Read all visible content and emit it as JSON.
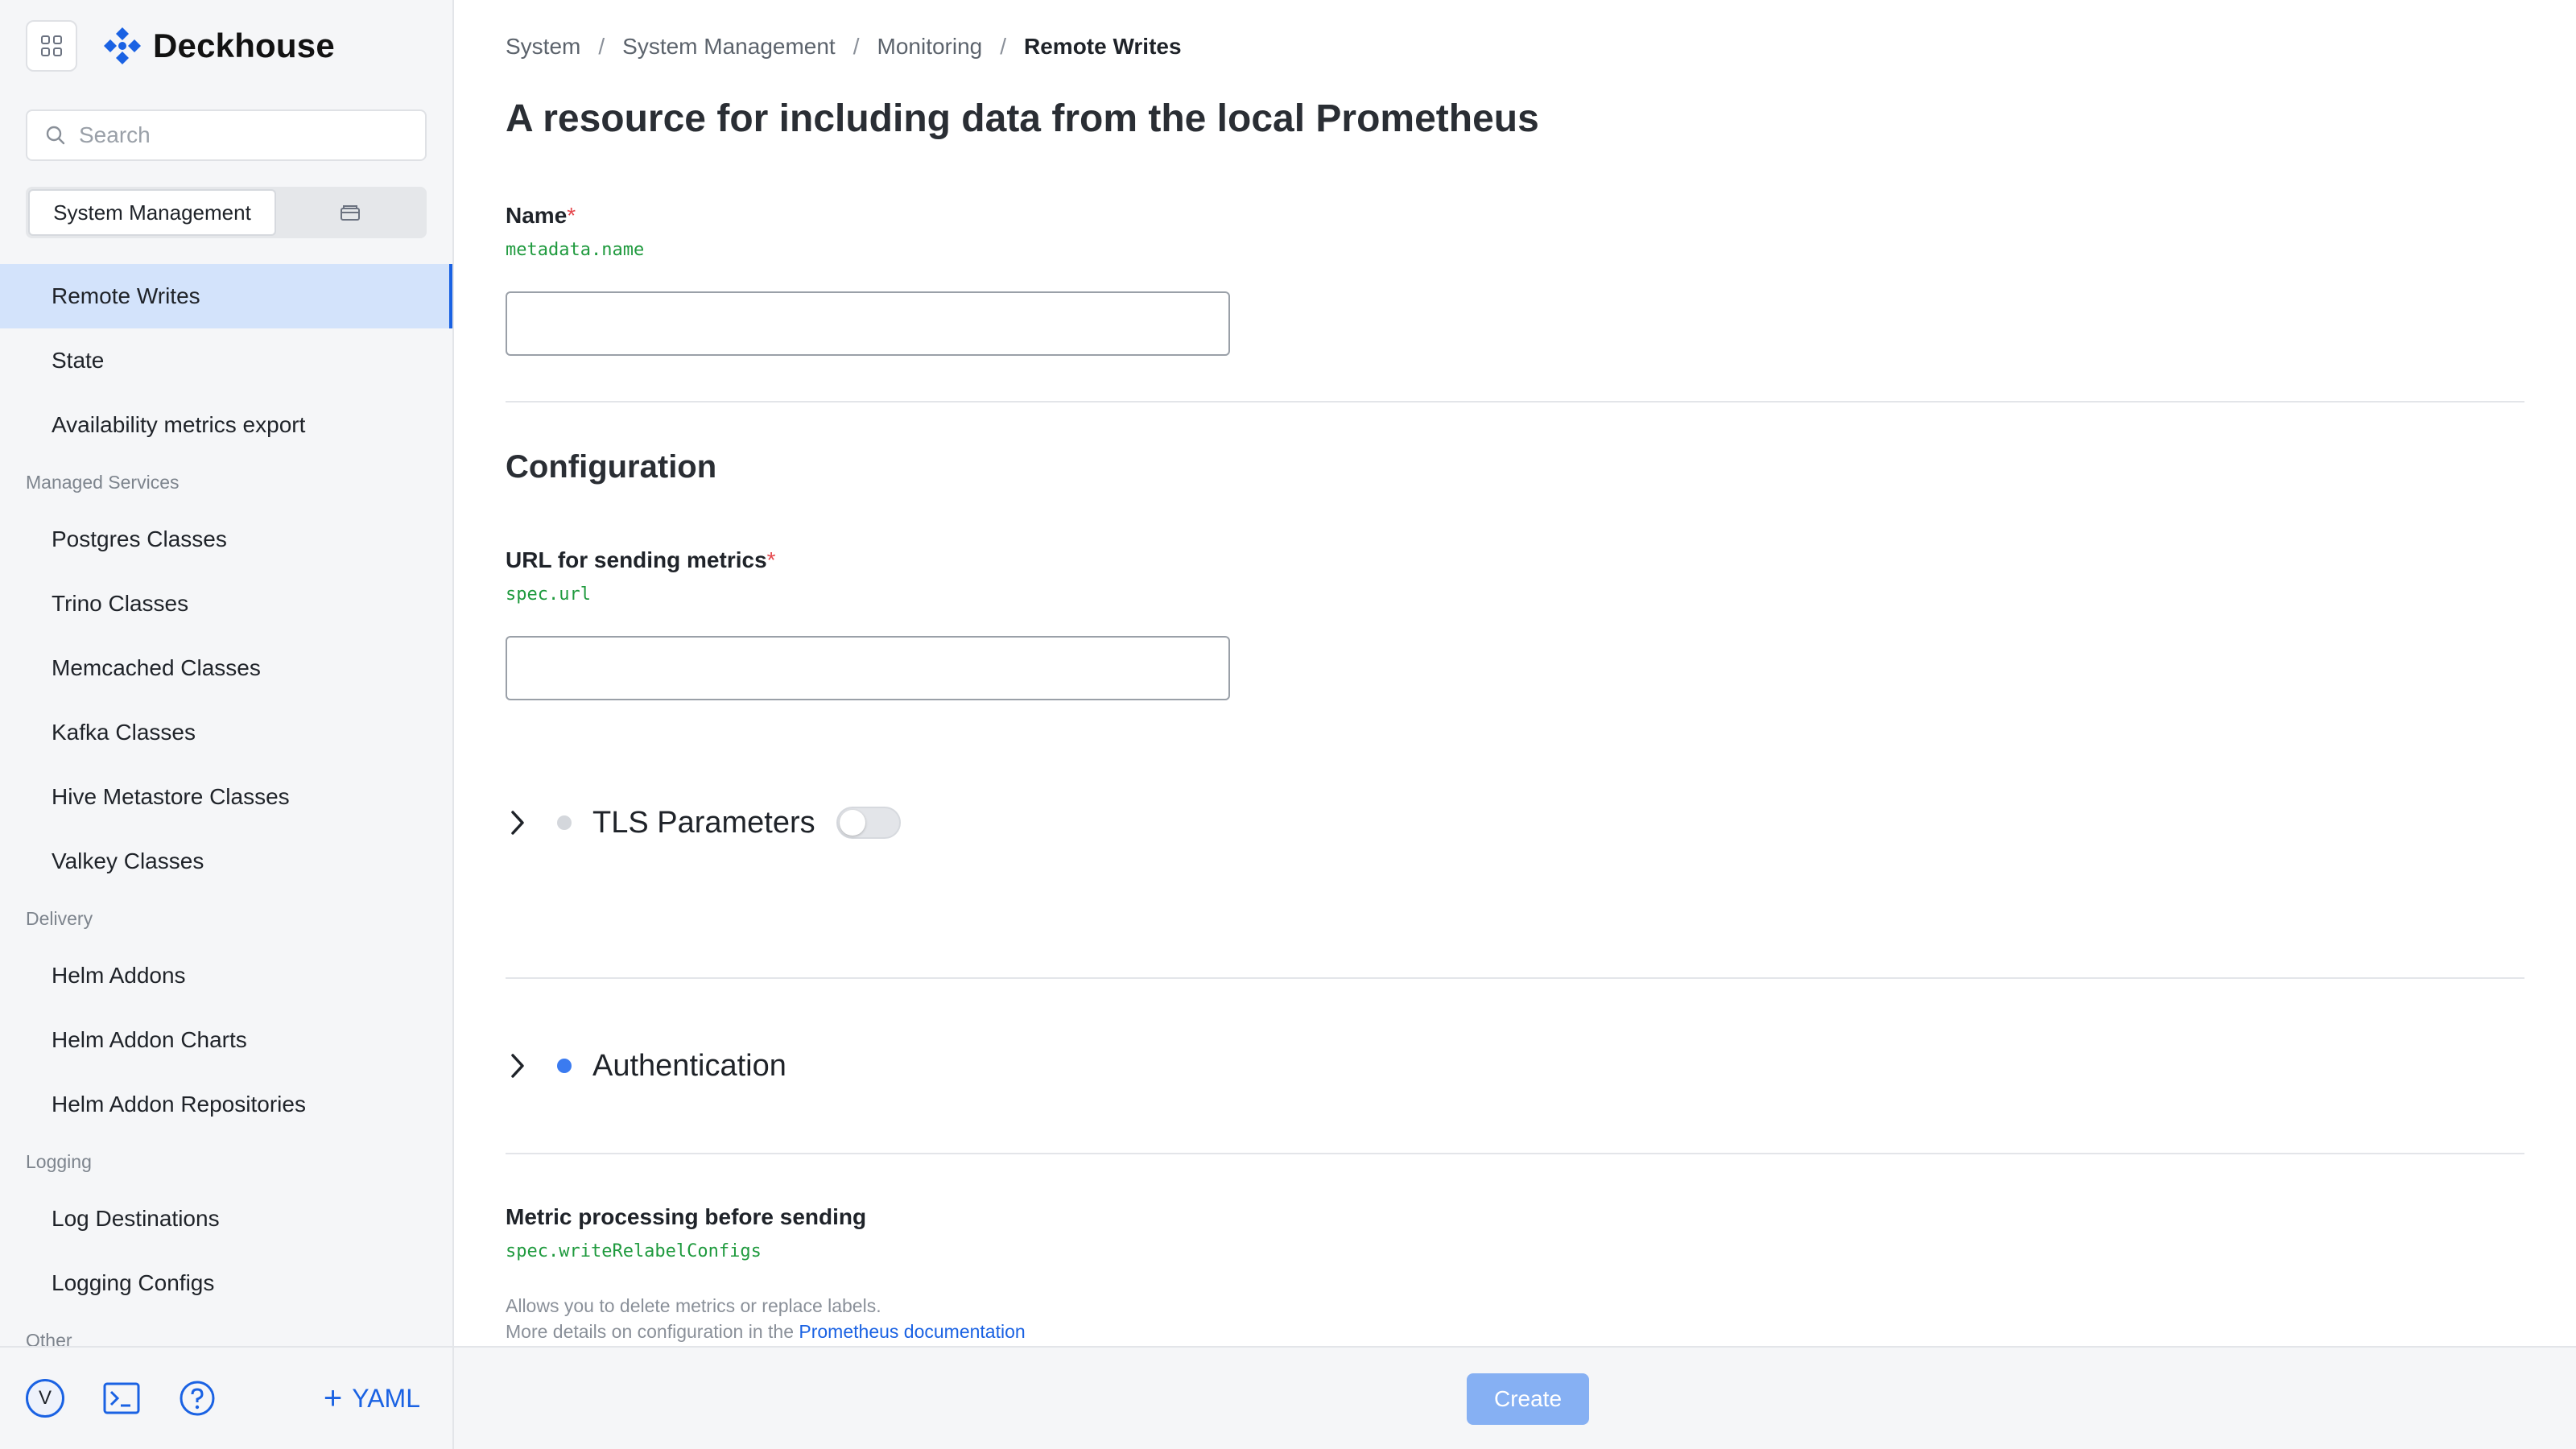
{
  "app": {
    "logo_text": "Deckhouse"
  },
  "sidebar": {
    "search_placeholder": "Search",
    "scope_label": "System Management",
    "items": [
      {
        "type": "item",
        "label": "Remote Writes",
        "active": true
      },
      {
        "type": "item",
        "label": "State"
      },
      {
        "type": "item",
        "label": "Availability metrics export"
      },
      {
        "type": "section",
        "label": "Managed Services"
      },
      {
        "type": "item",
        "label": "Postgres Classes"
      },
      {
        "type": "item",
        "label": "Trino Classes"
      },
      {
        "type": "item",
        "label": "Memcached Classes"
      },
      {
        "type": "item",
        "label": "Kafka Classes"
      },
      {
        "type": "item",
        "label": "Hive Metastore Classes"
      },
      {
        "type": "item",
        "label": "Valkey Classes"
      },
      {
        "type": "section",
        "label": "Delivery"
      },
      {
        "type": "item",
        "label": "Helm Addons"
      },
      {
        "type": "item",
        "label": "Helm Addon Charts"
      },
      {
        "type": "item",
        "label": "Helm Addon Repositories"
      },
      {
        "type": "section",
        "label": "Logging"
      },
      {
        "type": "item",
        "label": "Log Destinations"
      },
      {
        "type": "item",
        "label": "Logging Configs"
      },
      {
        "type": "section",
        "label": "Other"
      }
    ],
    "footer": {
      "avatar_letter": "V",
      "yaml_label": "YAML"
    }
  },
  "breadcrumbs": [
    "System",
    "System Management",
    "Monitoring",
    "Remote Writes"
  ],
  "page": {
    "title": "A resource for including data from the local Prometheus",
    "name_field": {
      "label": "Name",
      "required": "*",
      "path": "metadata.name",
      "value": ""
    },
    "configuration_title": "Configuration",
    "url_field": {
      "label": "URL for sending metrics",
      "required": "*",
      "path": "spec.url",
      "value": ""
    },
    "tls": {
      "title": "TLS Parameters",
      "enabled": false
    },
    "auth": {
      "title": "Authentication"
    },
    "relabel": {
      "label": "Metric processing before sending",
      "path": "spec.writeRelabelConfigs",
      "hint_line1": "Allows you to delete metrics or replace labels.",
      "hint_line2_prefix": "More details on configuration in the ",
      "hint_link": "Prometheus documentation"
    }
  },
  "actions": {
    "create_label": "Create"
  },
  "colors": {
    "accent": "#1a62e3",
    "active_bg": "#d3e3fb",
    "path_green": "#1f9a3e",
    "required_red": "#e5484d",
    "create_disabled": "#86b0f3"
  }
}
